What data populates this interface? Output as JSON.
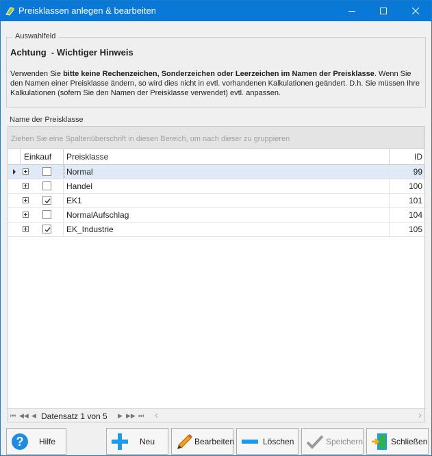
{
  "window": {
    "title": "Preisklassen anlegen & bearbeiten"
  },
  "groupbox": {
    "legend": "Auswahlfeld",
    "warning_title": "Achtung  - Wichtiger Hinweis",
    "text_part1": "Verwenden Sie ",
    "text_bold": "bitte keine Rechenzeichen, Sonderzeichen oder Leerzeichen im Namen der Preisklasse",
    "text_part2": ". Wenn Sie den Namen einer Preisklasse ändern, so wird dies nicht in evtl. vorhandenen Kalkulationen geändert. D.h. Sie müssen Ihre Kalkulationen (sofern Sie den Namen der Preisklasse verwendet) evtl. anpassen."
  },
  "grid": {
    "section_label": "Name der Preisklasse",
    "group_hint": "Ziehen Sie eine Spaltenüberschrift in diesen Bereich, um nach dieser zu gruppieren",
    "columns": {
      "einkauf": "Einkauf",
      "preisklasse": "Preisklasse",
      "id": "ID"
    },
    "rows": [
      {
        "einkauf": false,
        "preisklasse": "Normal",
        "id": "99",
        "selected": true
      },
      {
        "einkauf": false,
        "preisklasse": "Handel",
        "id": "100",
        "selected": false
      },
      {
        "einkauf": true,
        "preisklasse": "EK1",
        "id": "101",
        "selected": false
      },
      {
        "einkauf": false,
        "preisklasse": "NormalAufschlag",
        "id": "104",
        "selected": false
      },
      {
        "einkauf": true,
        "preisklasse": "EK_Industrie",
        "id": "105",
        "selected": false
      }
    ],
    "navigator_text": "Datensatz 1 von 5"
  },
  "buttons": {
    "hilfe": "Hilfe",
    "neu": "Neu",
    "bearbeiten": "Bearbeiten",
    "loeschen": "Löschen",
    "speichern": "Speichern",
    "schliessen": "Schließen"
  },
  "colors": {
    "titlebar": "#0a78d7",
    "selected_row": "#dfeaf6",
    "accent_blue": "#1e90e0"
  },
  "icons": {
    "title": "app-icon",
    "hilfe": "help-icon",
    "neu": "plus-icon",
    "bearbeiten": "pencil-icon",
    "loeschen": "minus-icon",
    "speichern": "checkmark-icon",
    "schliessen": "exit-door-icon"
  }
}
